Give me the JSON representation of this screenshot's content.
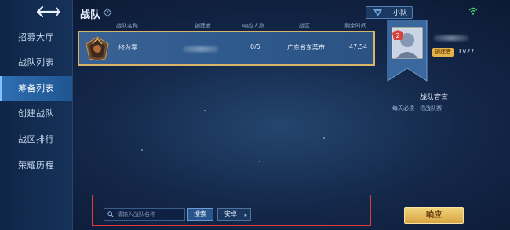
{
  "header": {
    "title": "战队",
    "squad_label": "小队"
  },
  "sidebar": {
    "items": [
      {
        "label": "招募大厅"
      },
      {
        "label": "战队列表"
      },
      {
        "label": "筹备列表"
      },
      {
        "label": "创建战队"
      },
      {
        "label": "战区排行"
      },
      {
        "label": "荣耀历程"
      }
    ],
    "active_index": 2
  },
  "table": {
    "columns": [
      "战队名称",
      "创建者",
      "响应人数",
      "战区",
      "剩余时间"
    ],
    "rows": [
      {
        "name": "终为零",
        "creator": "",
        "responses": "0/5",
        "region": "广东省东莞市",
        "time_left": "47:54"
      }
    ]
  },
  "profile": {
    "creator_tag": "创建者",
    "level": "Lv27",
    "badge_number": "2",
    "manifesto_title": "战队宣言",
    "manifesto_text": "每天必须一把战队赛"
  },
  "bottom": {
    "search_placeholder": "请输入战队名称",
    "search_label": "搜索",
    "region_label": "安卓",
    "respond_label": "响应"
  },
  "colors": {
    "accent_gold": "#d9b56a",
    "button_gold": "#e4b14a",
    "active_nav": "#2f6fb3",
    "highlight_border": "#e23a3a"
  }
}
